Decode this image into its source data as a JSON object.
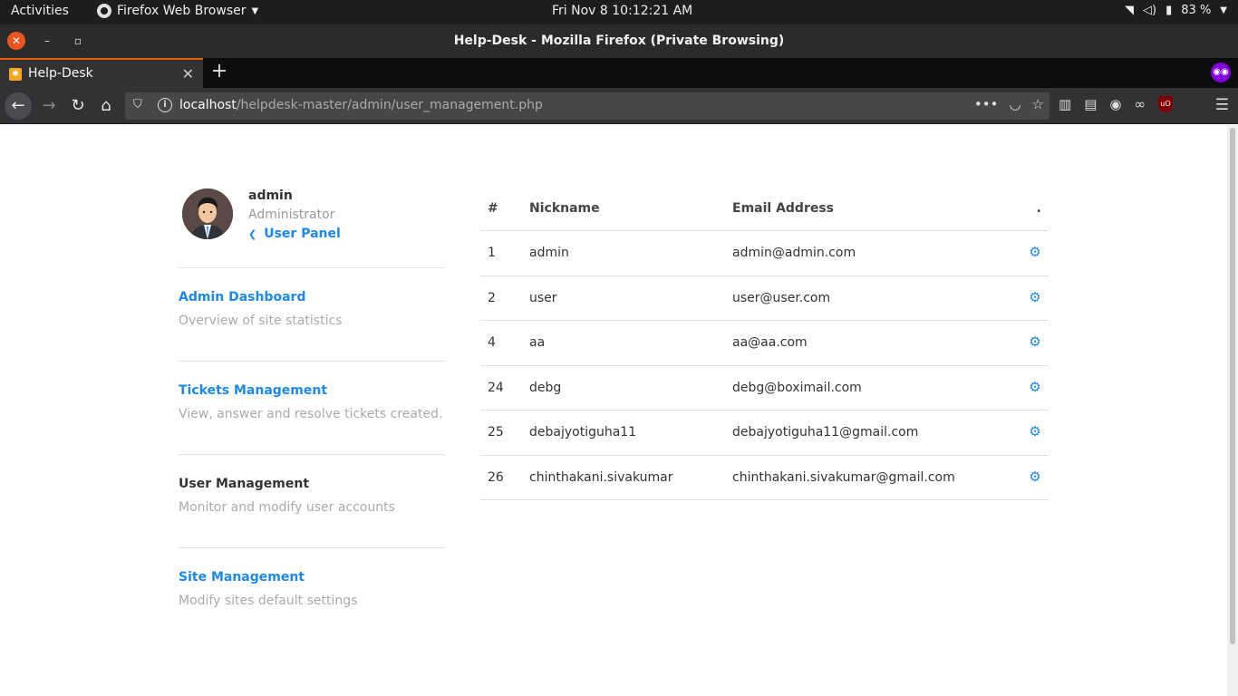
{
  "system_bar": {
    "activities": "Activities",
    "app_name": "Firefox Web Browser",
    "clock": "Fri Nov 8  10:12:21 AM",
    "battery": "83 %"
  },
  "window": {
    "title": "Help-Desk - Mozilla Firefox (Private Browsing)"
  },
  "tab": {
    "label": "Help-Desk"
  },
  "address_bar": {
    "host": "localhost",
    "path": "/helpdesk-master/admin/user_management.php"
  },
  "profile": {
    "name": "admin",
    "role": "Administrator",
    "panel_link": "User Panel"
  },
  "menu": [
    {
      "title": "Admin Dashboard",
      "desc": "Overview of site statistics"
    },
    {
      "title": "Tickets Management",
      "desc": "View, answer and resolve tickets created."
    },
    {
      "title": "User Management",
      "desc": "Monitor and modify user accounts"
    },
    {
      "title": "Site Management",
      "desc": "Modify sites default settings"
    }
  ],
  "table": {
    "headers": {
      "id": "#",
      "nickname": "Nickname",
      "email": "Email Address",
      "action": "."
    },
    "rows": [
      {
        "id": "1",
        "nickname": "admin",
        "email": "admin@admin.com"
      },
      {
        "id": "2",
        "nickname": "user",
        "email": "user@user.com"
      },
      {
        "id": "4",
        "nickname": "aa",
        "email": "aa@aa.com"
      },
      {
        "id": "24",
        "nickname": "debg",
        "email": "debg@boximail.com"
      },
      {
        "id": "25",
        "nickname": "debajyotiguha11",
        "email": "debajyotiguha11@gmail.com"
      },
      {
        "id": "26",
        "nickname": "chinthakani.sivakumar",
        "email": "chinthakani.sivakumar@gmail.com"
      }
    ]
  },
  "colors": {
    "link": "#1e88e5",
    "text": "#333333",
    "muted": "#aaaaaa"
  }
}
